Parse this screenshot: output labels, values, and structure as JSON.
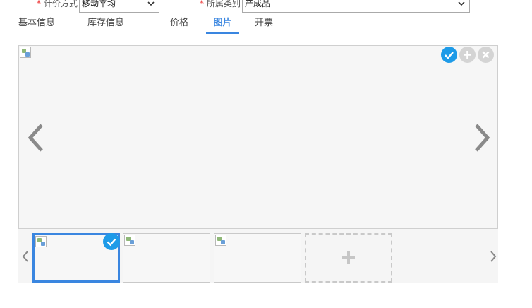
{
  "form": {
    "pricing_label": "计价方式",
    "pricing_value": "移动平均",
    "category_label": "所属类别",
    "category_value": "产成品",
    "required_mark": "*"
  },
  "tabs": [
    {
      "label": "基本信息",
      "active": false
    },
    {
      "label": "库存信息",
      "active": false
    },
    {
      "label": "价格",
      "active": false
    },
    {
      "label": "图片",
      "active": true
    },
    {
      "label": "开票",
      "active": false
    }
  ],
  "viewer": {
    "controls": [
      "check-icon",
      "plus-icon",
      "close-icon"
    ],
    "prev_icon": "chevron-left-icon",
    "next_icon": "chevron-right-icon"
  },
  "thumbnails": [
    {
      "selected": true
    },
    {
      "selected": false
    },
    {
      "selected": false
    }
  ],
  "add_tile_icon": "plus-icon",
  "colors": {
    "accent": "#3a86e0",
    "badge": "#1e9be8",
    "disabled_control": "#d4d4d4"
  }
}
